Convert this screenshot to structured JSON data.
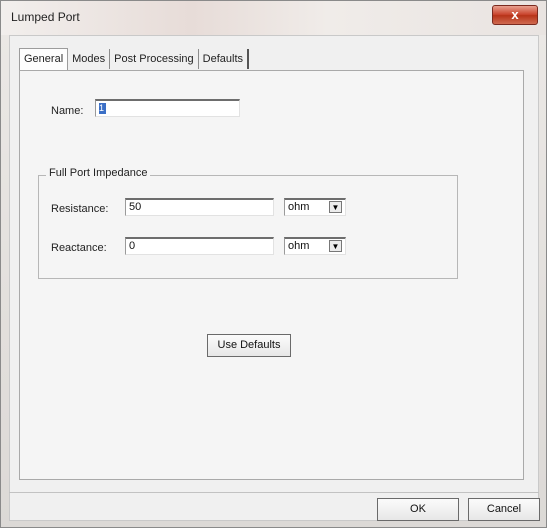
{
  "window": {
    "title": "Lumped Port",
    "close_glyph": "x"
  },
  "tabs": [
    {
      "label": "General",
      "active": true
    },
    {
      "label": "Modes",
      "active": false
    },
    {
      "label": "Post Processing",
      "active": false
    },
    {
      "label": "Defaults",
      "active": false
    }
  ],
  "general": {
    "name_label": "Name:",
    "name_value": "1",
    "impedance_group_title": "Full Port Impedance",
    "resistance_label": "Resistance:",
    "resistance_value": "50",
    "resistance_unit": "ohm",
    "reactance_label": "Reactance:",
    "reactance_value": "0",
    "reactance_unit": "ohm",
    "use_defaults_label": "Use Defaults"
  },
  "footer": {
    "ok_label": "OK",
    "cancel_label": "Cancel"
  },
  "colors": {
    "close_red": "#c9432c",
    "selection_blue": "#3b6fc6"
  }
}
